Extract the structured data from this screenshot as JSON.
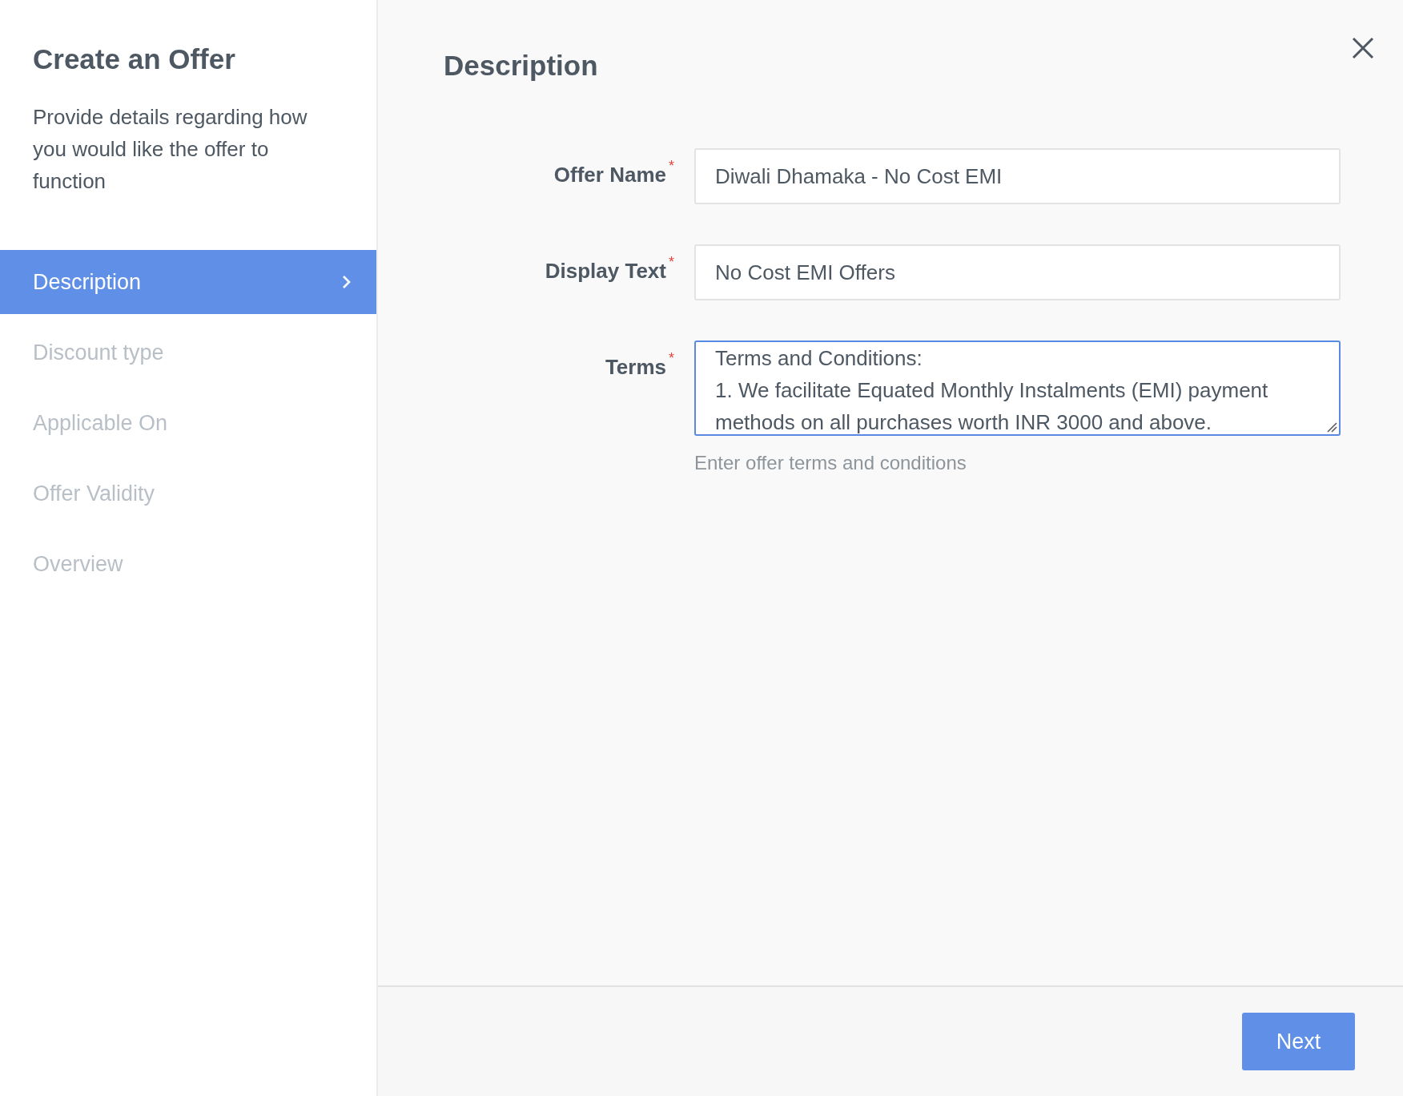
{
  "sidebar": {
    "title": "Create an Offer",
    "description": "Provide details regarding how you would like the offer to function",
    "steps": [
      {
        "label": "Description",
        "selected": true
      },
      {
        "label": "Discount type",
        "selected": false
      },
      {
        "label": "Applicable On",
        "selected": false
      },
      {
        "label": "Offer Validity",
        "selected": false
      },
      {
        "label": "Overview",
        "selected": false
      }
    ]
  },
  "main": {
    "title": "Description",
    "fields": [
      {
        "kind": "input",
        "label": "Offer Name",
        "required_mark": "*",
        "focused": false,
        "value": "Diwali Dhamaka - No Cost EMI"
      },
      {
        "kind": "input",
        "label": "Display Text",
        "required_mark": "*",
        "focused": false,
        "value": "No Cost EMI Offers"
      },
      {
        "kind": "textarea",
        "label": "Terms",
        "required_mark": "*",
        "focused": true,
        "value": [
          "Terms and Conditions:",
          "1. We facilitate Equated Monthly Instalments (EMI) payment methods on all purchases worth INR 3000 and above."
        ],
        "help": "Enter offer terms and conditions"
      }
    ]
  },
  "footer": {
    "next_button": "Next"
  }
}
